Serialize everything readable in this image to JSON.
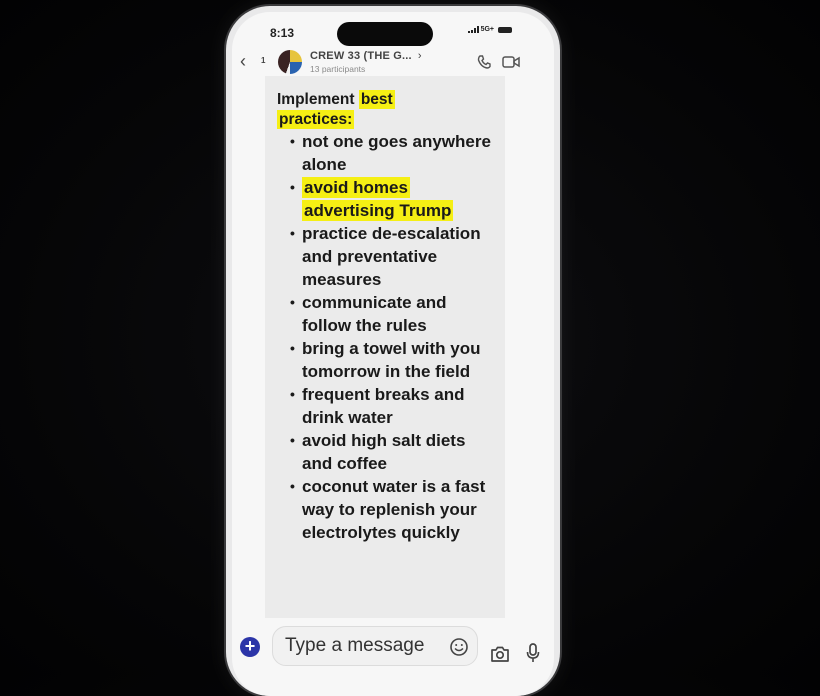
{
  "status_bar": {
    "time": "8:13",
    "network": "5G+",
    "signal_icon": "cellular-signal-icon",
    "battery_icon": "battery-icon"
  },
  "header": {
    "back_icon": "chevron-left-icon",
    "unread_count": "1",
    "chat_title": "CREW 33 (THE G...",
    "title_chevron": "›",
    "participants": "13 participants",
    "call_icon": "phone-icon",
    "video_icon": "video-camera-icon"
  },
  "message": {
    "intro_plain": "Implement ",
    "intro_highlight_1": "best",
    "intro_highlight_2": "practices:",
    "items": [
      {
        "text": "not one goes anywhere alone",
        "highlighted": false
      },
      {
        "text": "avoid homes advertising Trump",
        "highlighted": true
      },
      {
        "text": "practice de-escalation and preventative measures",
        "highlighted": false
      },
      {
        "text": "communicate and follow the rules",
        "highlighted": false
      },
      {
        "text": "bring a towel with you tomorrow in the field",
        "highlighted": false
      },
      {
        "text": "frequent breaks and drink water",
        "highlighted": false
      },
      {
        "text": "avoid high salt diets and coffee",
        "highlighted": false
      },
      {
        "text": "coconut water is a fast way to replenish your electrolytes quickly",
        "highlighted": false
      }
    ],
    "bullet": "•",
    "highlight_color": "#f5ef14"
  },
  "composer": {
    "plus_label": "+",
    "placeholder": "Type a message",
    "emoji_icon": "smiley-icon",
    "camera_icon": "camera-icon",
    "mic_icon": "microphone-icon",
    "accent_color": "#2c35a8"
  }
}
